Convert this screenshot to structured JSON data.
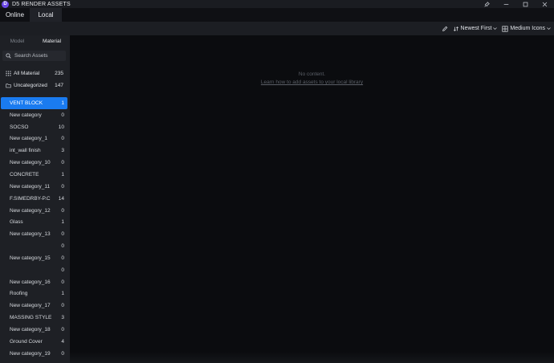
{
  "app": {
    "title": "D5 RENDER ASSETS",
    "logo_letter": "D"
  },
  "tabs": [
    {
      "label": "Online"
    },
    {
      "label": "Local"
    }
  ],
  "toolbar": {
    "sort_label": "Newest First",
    "view_label": "Medium Icons"
  },
  "sidebar": {
    "tabs": [
      {
        "label": "Model"
      },
      {
        "label": "Material"
      }
    ],
    "search_placeholder": "Search Assets",
    "summary": [
      {
        "label": "All Material",
        "count": "235"
      },
      {
        "label": "Uncategorized",
        "count": "147"
      }
    ],
    "categories": [
      {
        "label": "VENT BLOCK",
        "count": "1"
      },
      {
        "label": "New category",
        "count": "0"
      },
      {
        "label": "SOCSO",
        "count": "10"
      },
      {
        "label": "New category_1",
        "count": "0"
      },
      {
        "label": "int_wall finish",
        "count": "3"
      },
      {
        "label": "New category_10",
        "count": "0"
      },
      {
        "label": "CONCRETE",
        "count": "1"
      },
      {
        "label": "New category_11",
        "count": "0"
      },
      {
        "label": "F.SIMEDRBY-P.C",
        "count": "14"
      },
      {
        "label": "New category_12",
        "count": "0"
      },
      {
        "label": "Glass",
        "count": "1"
      },
      {
        "label": "New category_13",
        "count": "0"
      },
      {
        "label": "",
        "count": "0"
      },
      {
        "label": "New category_15",
        "count": "0"
      },
      {
        "label": "",
        "count": "0"
      },
      {
        "label": "New category_16",
        "count": "0"
      },
      {
        "label": "Roofing",
        "count": "1"
      },
      {
        "label": "New category_17",
        "count": "0"
      },
      {
        "label": "MASSING STYLE",
        "count": "3"
      },
      {
        "label": "New category_18",
        "count": "0"
      },
      {
        "label": "Ground Cover",
        "count": "4"
      },
      {
        "label": "New category_19",
        "count": "0"
      }
    ]
  },
  "content": {
    "empty_message": "No content.",
    "help_link": "Learn how to add assets to your local library"
  },
  "colors": {
    "accent": "#1a7bf0",
    "brand": "#6b48e8"
  }
}
